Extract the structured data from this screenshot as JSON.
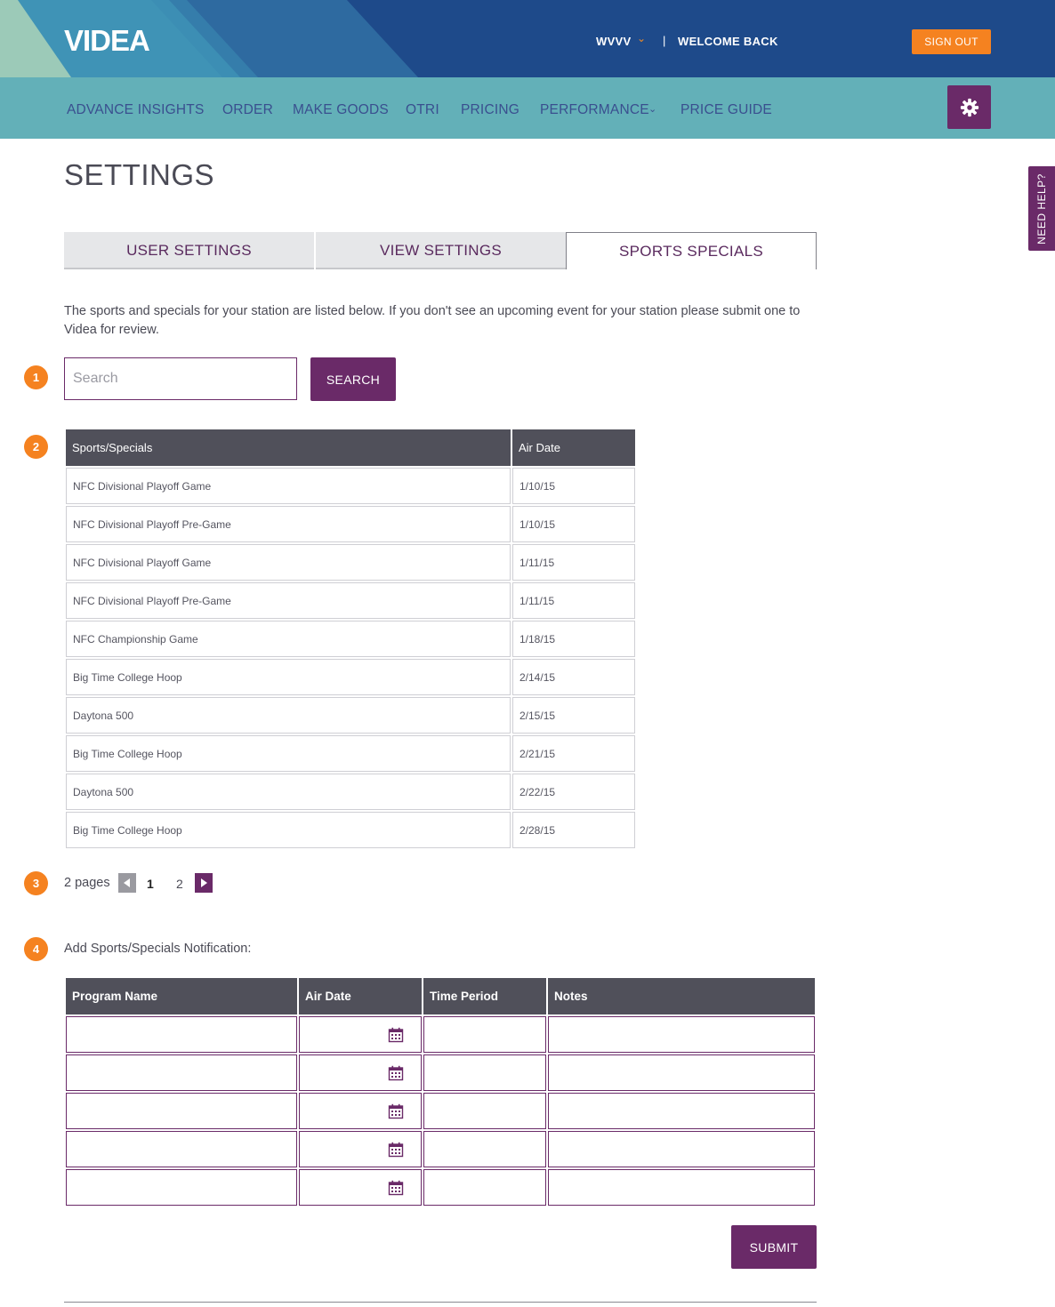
{
  "header": {
    "logo_text": "VIDEA",
    "station": "WVVV",
    "separator": "|",
    "welcome": "WELCOME BACK",
    "sign_out": "SIGN OUT"
  },
  "nav": {
    "items": [
      "ADVANCE INSIGHTS",
      "ORDER",
      "MAKE GOODS",
      "OTRI",
      "PRICING",
      "PERFORMANCE",
      "PRICE GUIDE"
    ]
  },
  "need_help": "NEED HELP?",
  "page": {
    "title": "SETTINGS",
    "tabs": [
      "USER SETTINGS",
      "VIEW SETTINGS",
      "SPORTS SPECIALS"
    ],
    "active_tab": "SPORTS SPECIALS",
    "intro": "The sports and specials for your station are listed below. If you don't see an upcoming event for your station please submit one to Videa for review."
  },
  "steps": [
    "1",
    "2",
    "3",
    "4"
  ],
  "search": {
    "placeholder": "Search",
    "button": "SEARCH"
  },
  "results": {
    "columns": [
      "Sports/Specials",
      "Air Date"
    ],
    "rows": [
      [
        "NFC Divisional Playoff Game",
        "1/10/15"
      ],
      [
        "NFC Divisional Playoff Pre-Game",
        "1/10/15"
      ],
      [
        "NFC Divisional Playoff Game",
        "1/11/15"
      ],
      [
        "NFC Divisional Playoff Pre-Game",
        "1/11/15"
      ],
      [
        "NFC Championship Game",
        "1/18/15"
      ],
      [
        "Big Time College Hoop",
        "2/14/15"
      ],
      [
        "Daytona 500",
        "2/15/15"
      ],
      [
        "Big Time College Hoop",
        "2/21/15"
      ],
      [
        "Daytona 500",
        "2/22/15"
      ],
      [
        "Big Time College Hoop",
        "2/28/15"
      ]
    ]
  },
  "pagination": {
    "label": "2 pages",
    "pages": [
      "1",
      "2"
    ],
    "current": "1"
  },
  "add_form": {
    "label": "Add Sports/Specials Notification:",
    "columns": [
      "Program Name",
      "Air Date",
      "Time Period",
      "Notes"
    ],
    "row_count": 5,
    "submit": "SUBMIT"
  },
  "colors": {
    "brand_purple": "#6a2a68",
    "accent_orange": "#f58220",
    "nav_teal": "#63b0b8",
    "header_blue": "#1e4a8a",
    "table_header": "#50505a"
  }
}
